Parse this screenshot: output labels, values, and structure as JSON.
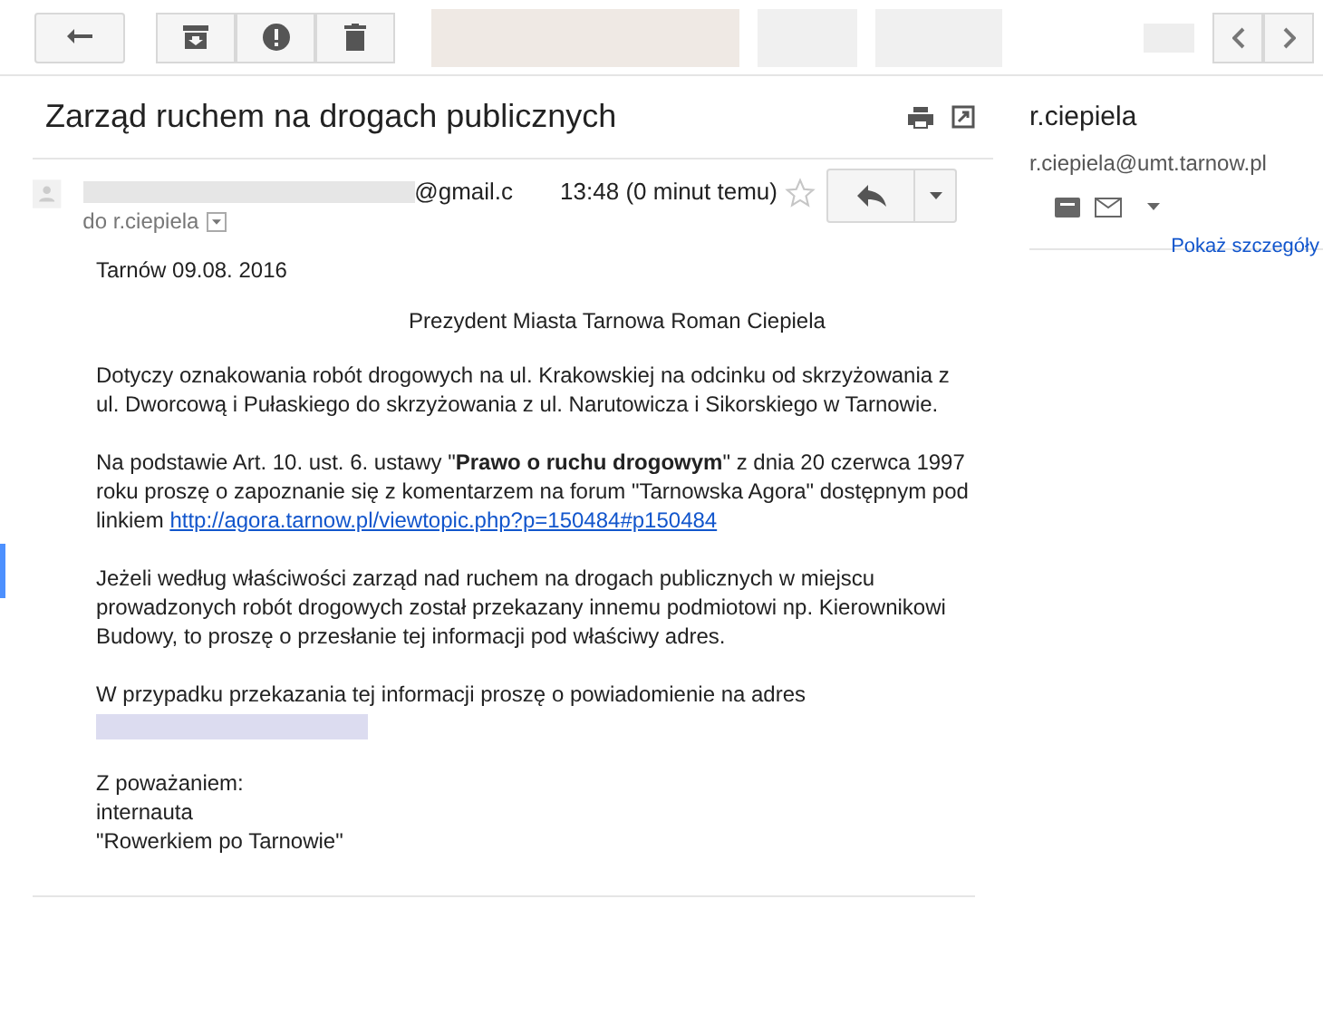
{
  "toolbar": {
    "buttons": [
      {
        "kind": "back"
      },
      {
        "kind": "archive"
      },
      {
        "kind": "spam"
      },
      {
        "kind": "delete"
      }
    ],
    "nav": [
      {
        "kind": "prev"
      },
      {
        "kind": "next"
      }
    ]
  },
  "subject": "Zarząd ruchem na drogach publicznych",
  "message": {
    "sender_domain": "@gmail.c",
    "time": "13:48 (0 minut temu)",
    "starred": false,
    "recipient": "do r.ciepiela"
  },
  "body": [
    {
      "kind": "text",
      "text": "Tarnów 09.08. 2016"
    },
    {
      "kind": "center",
      "text": "Prezydent Miasta Tarnowa Roman Ciepiela"
    },
    {
      "kind": "text",
      "text": "Dotyczy oznakowania robót drogowych na ul. Krakowskiej na odcinku od skrzyżowania z ul. Dworcową i Pułaskiego do skrzyżowania z ul. Narutowicza i Sikorskiego w Tarnowie."
    },
    {
      "kind": "link",
      "text": "Na podstawie Art. 10. ust. 6. ustawy \"**Prawo o ruchu drogowym**\" z dnia 20 czerwca 1997 roku proszę o zapoznanie się z komentarzem na  forum \"Tarnowska Agora\" dostępnym pod linkiem",
      "link": "http://agora.tarnow.pl/viewtopic.php?p=150484#p150484"
    },
    {
      "kind": "text",
      "text": "Jeżeli według właściwości zarząd nad ruchem na drogach publicznych w miejscu prowadzonych robót drogowych został przekazany innemu podmiotowi np. Kierownikowi Budowy, to proszę o przesłanie tej informacji pod właściwy adres."
    },
    {
      "kind": "redacted",
      "text": "W przypadku przekazania tej informacji proszę o powiadomienie na adres"
    },
    {
      "kind": "lines",
      "lines": [
        "Z poważaniem:",
        "internauta",
        "\"Rowerkiem po Tarnowie\""
      ]
    }
  ],
  "contact": {
    "name": "r.ciepiela",
    "email": "r.ciepiela@umt.tarnow.pl",
    "details_link": "Pokaż szczegóły"
  }
}
